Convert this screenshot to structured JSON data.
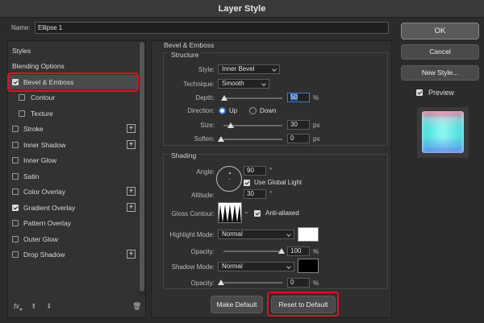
{
  "window": {
    "title": "Layer Style"
  },
  "name_field": {
    "label": "Name:",
    "value": "Ellipse 1"
  },
  "left_panel": {
    "styles_header": "Styles",
    "blending_options": "Blending Options",
    "items": [
      {
        "label": "Bevel & Emboss",
        "checked": true,
        "has_plus": false
      },
      {
        "label": "Contour",
        "checked": false,
        "has_plus": false
      },
      {
        "label": "Texture",
        "checked": false,
        "has_plus": false
      },
      {
        "label": "Stroke",
        "checked": false,
        "has_plus": true
      },
      {
        "label": "Inner Shadow",
        "checked": false,
        "has_plus": true
      },
      {
        "label": "Inner Glow",
        "checked": false,
        "has_plus": false
      },
      {
        "label": "Satin",
        "checked": false,
        "has_plus": false
      },
      {
        "label": "Color Overlay",
        "checked": false,
        "has_plus": true
      },
      {
        "label": "Gradient Overlay",
        "checked": true,
        "has_plus": true
      },
      {
        "label": "Pattern Overlay",
        "checked": false,
        "has_plus": false
      },
      {
        "label": "Outer Glow",
        "checked": false,
        "has_plus": false
      },
      {
        "label": "Drop Shadow",
        "checked": false,
        "has_plus": true
      }
    ],
    "footer_icons": [
      "fx-icon",
      "arrow-up-icon",
      "arrow-down-icon",
      "trash-icon"
    ]
  },
  "bevel": {
    "section_title": "Bevel & Emboss",
    "structure_title": "Structure",
    "style_label": "Style:",
    "style_value": "Inner Bevel",
    "technique_label": "Technique:",
    "technique_value": "Smooth",
    "depth_label": "Depth:",
    "depth_value": "50",
    "depth_unit": "%",
    "direction_label": "Direction:",
    "direction_up": "Up",
    "direction_down": "Down",
    "size_label": "Size:",
    "size_value": "30",
    "size_unit": "px",
    "soften_label": "Soften:",
    "soften_value": "0",
    "soften_unit": "px"
  },
  "shading": {
    "title": "Shading",
    "angle_label": "Angle:",
    "angle_value": "90",
    "angle_unit": "°",
    "use_global_light": "Use Global Light",
    "altitude_label": "Altitude:",
    "altitude_value": "30",
    "altitude_unit": "°",
    "gloss_contour_label": "Gloss Contour:",
    "anti_aliased": "Anti-aliased",
    "highlight_mode_label": "Highlight Mode:",
    "highlight_mode_value": "Normal",
    "highlight_color": "#ffffff",
    "highlight_opacity_label": "Opacity:",
    "highlight_opacity_value": "100",
    "highlight_opacity_unit": "%",
    "shadow_mode_label": "Shadow Mode:",
    "shadow_mode_value": "Normal",
    "shadow_color": "#000000",
    "shadow_opacity_label": "Opacity:",
    "shadow_opacity_value": "0",
    "shadow_opacity_unit": "%"
  },
  "buttons": {
    "make_default": "Make Default",
    "reset_to_default": "Reset to Default",
    "ok": "OK",
    "cancel": "Cancel",
    "new_style": "New Style...",
    "preview": "Preview"
  },
  "colors": {
    "highlight_ring": "#e01020",
    "accent": "#3a7bd5"
  }
}
